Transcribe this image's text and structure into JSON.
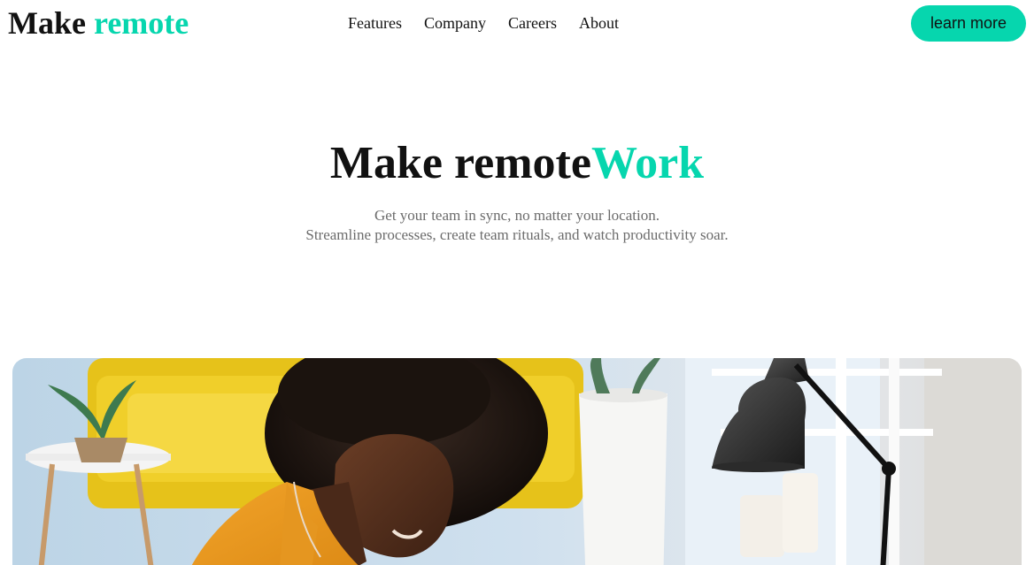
{
  "header": {
    "logo": {
      "part1": "Make ",
      "part2": "remote"
    },
    "nav": [
      {
        "label": "Features"
      },
      {
        "label": "Company"
      },
      {
        "label": "Careers"
      },
      {
        "label": "About"
      }
    ],
    "cta_label": "learn more"
  },
  "hero": {
    "title_part1": "Make remote",
    "title_part2": "Work",
    "subtitle_line1": "Get your team in sync, no matter your location.",
    "subtitle_line2": "Streamline processes, create team rituals, and watch productivity soar."
  },
  "colors": {
    "accent": "#06d6ae",
    "text": "#111111",
    "muted": "#6b6b6b"
  },
  "icons": {
    "hero_image": "woman-working-at-desk-photo"
  }
}
